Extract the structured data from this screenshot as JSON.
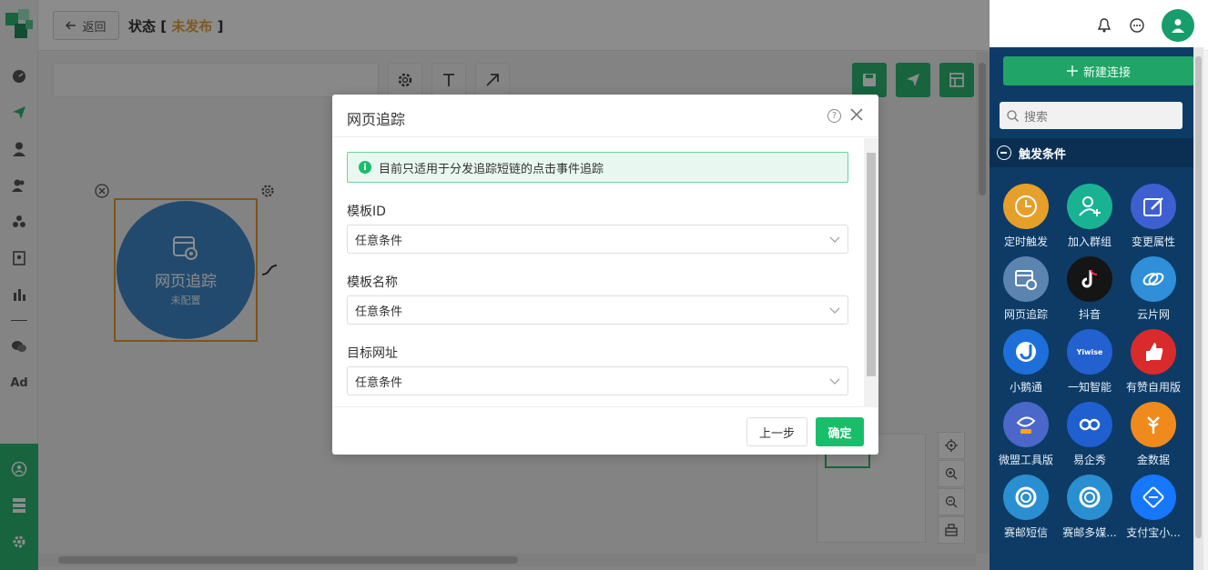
{
  "header": {
    "back_label": "返回",
    "status_label": "状态 [",
    "status_value": "未发布",
    "status_close": "]"
  },
  "node": {
    "title": "网页追踪",
    "subtitle": "未配置"
  },
  "sidebar": {
    "ad_label": "Ad"
  },
  "right_panel": {
    "new_connection": "新建连接",
    "search_placeholder": "搜索",
    "section_title": "触发条件",
    "items": [
      {
        "label": "定时触发",
        "color": "#e6a02a"
      },
      {
        "label": "加入群组",
        "color": "#19b394"
      },
      {
        "label": "变更属性",
        "color": "#3d5fd0"
      },
      {
        "label": "网页追踪",
        "color": "#5b84b0"
      },
      {
        "label": "抖音",
        "color": "#151515"
      },
      {
        "label": "云片网",
        "color": "#2f8fd8"
      },
      {
        "label": "小鹅通",
        "color": "#1e6fd9"
      },
      {
        "label": "一知智能",
        "color": "#2360d0",
        "badge": "Yiwise"
      },
      {
        "label": "有赞自用版",
        "color": "#d92b2b"
      },
      {
        "label": "微盟工具版",
        "color": "#4a67c9"
      },
      {
        "label": "易企秀",
        "color": "#1f5fd0"
      },
      {
        "label": "金数据",
        "color": "#f08a1d"
      },
      {
        "label": "赛邮短信",
        "color": "#2a8fd0"
      },
      {
        "label": "赛邮多媒...",
        "color": "#2a8fd0"
      },
      {
        "label": "支付宝小...",
        "color": "#1677ff"
      }
    ]
  },
  "modal": {
    "title": "网页追踪",
    "notice": "目前只适用于分发追踪短链的点击事件追踪",
    "fields": [
      {
        "label": "模板ID",
        "value": "任意条件"
      },
      {
        "label": "模板名称",
        "value": "任意条件"
      },
      {
        "label": "目标网址",
        "value": "任意条件"
      }
    ],
    "prev_label": "上一步",
    "ok_label": "确定"
  }
}
